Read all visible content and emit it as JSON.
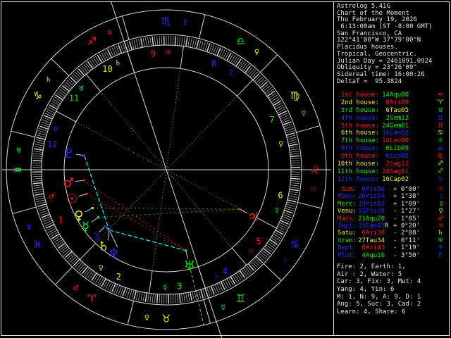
{
  "app_title": "Astrolog 5.41G",
  "panel": {
    "header_lines": [
      "Astrolog 5.41G",
      "Chart of the Moment",
      "Thu February 19, 2026",
      " 6:13:00am (ST -8:00 GMT)",
      "San Francisco, CA",
      "122°41'00\"W 37°79'00\"N",
      "Placidus houses.",
      "Tropical, Geocentric.",
      "Julian Day = 2461091.0924",
      "Obliquity = 23°26'09\"",
      "Sidereal time: 16:00:26",
      "DeltaT =  95.3824"
    ],
    "houses": [
      {
        "label": "1st house:",
        "value": "14Aqu00",
        "label_color": "#ff1818",
        "value_color": "#00ee00",
        "glyph": "♒",
        "glyph_color": "#ff1818"
      },
      {
        "label": "2nd house:",
        "value": "0Ari09",
        "label_color": "#eeee00",
        "value_color": "#ff1818",
        "glyph": "♈",
        "glyph_color": "#eeee00"
      },
      {
        "label": "3rd house:",
        "value": "6Tau05",
        "label_color": "#00ee00",
        "value_color": "#eeee00",
        "glyph": "♉",
        "glyph_color": "#00ee00"
      },
      {
        "label": "4th house:",
        "value": "2Gem12",
        "label_color": "#2a2aff",
        "value_color": "#00ee00",
        "glyph": "♊",
        "glyph_color": "#2a2aff"
      },
      {
        "label": "5th house:",
        "value": "24Gem01",
        "label_color": "#ff1818",
        "value_color": "#00ee00",
        "glyph": "♊",
        "glyph_color": "#ff1818"
      },
      {
        "label": "6th house:",
        "value": "16Can02",
        "label_color": "#eeee00",
        "value_color": "#2a2aff",
        "glyph": "♋",
        "glyph_color": "#eeee00"
      },
      {
        "label": "7th house:",
        "value": "14Leo00",
        "label_color": "#00ee00",
        "value_color": "#ff1818",
        "glyph": "♌",
        "glyph_color": "#00ee00"
      },
      {
        "label": "8th house:",
        "value": "0Lib09",
        "label_color": "#2a2aff",
        "value_color": "#00ee00",
        "glyph": "♎",
        "glyph_color": "#2a2aff"
      },
      {
        "label": "9th house:",
        "value": "6Sco05",
        "label_color": "#ff1818",
        "value_color": "#2a2aff",
        "glyph": "♏",
        "glyph_color": "#ff1818"
      },
      {
        "label": "10th house:",
        "value": "2Sag12",
        "label_color": "#eeee00",
        "value_color": "#ff1818",
        "glyph": "♐",
        "glyph_color": "#eeee00"
      },
      {
        "label": "11th house:",
        "value": "24Sag01",
        "label_color": "#00ee00",
        "value_color": "#ff1818",
        "glyph": "♐",
        "glyph_color": "#00ee00"
      },
      {
        "label": "12th house:",
        "value": "16Cap02",
        "label_color": "#2a2aff",
        "value_color": "#eeee00",
        "glyph": "♑",
        "glyph_color": "#2a2aff"
      }
    ],
    "planets": [
      {
        "name": "Sun:",
        "value": "0Pis56",
        "retro": " ",
        "velocity": "+ 0°00'",
        "name_color": "#ff1818",
        "value_color": "#2a2aff",
        "glyph": "☉",
        "glyph_color": "#ff1818"
      },
      {
        "name": "Moon:",
        "value": "26Pis54",
        "retro": " ",
        "velocity": "+ 1°38'",
        "name_color": "#2a2aff",
        "value_color": "#2a2aff",
        "glyph": "☽",
        "glyph_color": "#2a2aff"
      },
      {
        "name": "Merc:",
        "value": "19Pis02",
        "retro": " ",
        "velocity": "+ 1°09'",
        "name_color": "#00ee00",
        "value_color": "#2a2aff",
        "glyph": "☿",
        "glyph_color": "#00ee00"
      },
      {
        "name": "Venu:",
        "value": "11Pis28",
        "retro": " ",
        "velocity": "- 1°27'",
        "name_color": "#eeee00",
        "value_color": "#2a2aff",
        "glyph": "♀",
        "glyph_color": "#eeee00"
      },
      {
        "name": "Mars:",
        "value": "21Aqu20",
        "retro": " ",
        "velocity": "- 1°05'",
        "name_color": "#ff1818",
        "value_color": "#00ee00",
        "glyph": "♂",
        "glyph_color": "#ff1818"
      },
      {
        "name": "Jupi:",
        "value": "15Can43",
        "retro": "R",
        "velocity": "+ 0°20'",
        "name_color": "#2a2aff",
        "value_color": "#2a2aff",
        "glyph": "♃",
        "glyph_color": "#ff1818"
      },
      {
        "name": "Satu:",
        "value": "0Ari38",
        "retro": " ",
        "velocity": "- 2°08'",
        "name_color": "#eeee00",
        "value_color": "#ff1818",
        "glyph": "♄",
        "glyph_color": "#eeee00"
      },
      {
        "name": "Uran:",
        "value": "27Tau34",
        "retro": " ",
        "velocity": "- 0°11'",
        "name_color": "#00ee00",
        "value_color": "#eeee00",
        "glyph": "♅",
        "glyph_color": "#00ee00"
      },
      {
        "name": "Nept:",
        "value": "0Ari43",
        "retro": " ",
        "velocity": "- 1°19'",
        "name_color": "#2a2aff",
        "value_color": "#ff1818",
        "glyph": "♆",
        "glyph_color": "#2a2aff"
      },
      {
        "name": "Plut:",
        "value": "4Aqu16",
        "retro": " ",
        "velocity": "- 3°50'",
        "name_color": "#2a2aff",
        "value_color": "#00ee00",
        "glyph": "♇",
        "glyph_color": "#2a2aff"
      }
    ],
    "stats_lines": [
      "Fire: 2, Earth: 1,",
      "Air : 2, Water: 5",
      "Car: 3, Fix: 3, Mut: 4",
      "Yang: 4, Yin: 6",
      "M: 1, N: 9, A: 9, D: 1",
      "Ang: 5, Suc: 3, Cad: 2",
      "Learn: 4, Share: 6"
    ]
  },
  "wheel": {
    "ascendant_lon": 314.0,
    "house_cusps_lon": [
      314.0,
      0.15,
      36.083,
      62.2,
      84.017,
      106.033,
      134.0,
      180.15,
      216.083,
      242.2,
      264.017,
      286.033
    ],
    "house_numbers": [
      "1",
      "2",
      "3",
      "4",
      "5",
      "6",
      "7",
      "8",
      "9",
      "10",
      "11",
      "12"
    ],
    "house_number_colors": [
      "#ff1818",
      "#eeee00",
      "#00ee00",
      "#2a2aff",
      "#ff1818",
      "#eeee00",
      "#00ee00",
      "#2a2aff",
      "#ff1818",
      "#eeee00",
      "#00ee00",
      "#2a2aff"
    ],
    "house_ruler_glyphs": [
      "♂",
      "♀",
      "☿",
      "☽",
      "☉",
      "☿",
      "♀",
      "♇",
      "♃",
      "♄",
      "♅",
      "♆"
    ],
    "house_ruler_colors": [
      "#ff1818",
      "#eeee00",
      "#00ee00",
      "#2a2aff",
      "#ff1818",
      "#00ee00",
      "#eeee00",
      "#2a2aff",
      "#ff1818",
      "#eeee00",
      "#00ee00",
      "#2a2aff"
    ],
    "signs": [
      {
        "name": "Aries",
        "glyph": "♈",
        "color": "#ff1818",
        "ruler_glyph": "♂",
        "ruler_color": "#ff1818"
      },
      {
        "name": "Taurus",
        "glyph": "♉",
        "color": "#eeee00",
        "ruler_glyph": "♀",
        "ruler_color": "#eeee00"
      },
      {
        "name": "Gemini",
        "glyph": "♊",
        "color": "#00ee00",
        "ruler_glyph": "☿",
        "ruler_color": "#00ee00"
      },
      {
        "name": "Cancer",
        "glyph": "♋",
        "color": "#2a2aff",
        "ruler_glyph": "☽",
        "ruler_color": "#2a2aff"
      },
      {
        "name": "Leo",
        "glyph": "♌",
        "color": "#ff1818",
        "ruler_glyph": "☉",
        "ruler_color": "#ff1818"
      },
      {
        "name": "Virgo",
        "glyph": "♍",
        "color": "#eeee00",
        "ruler_glyph": "☿",
        "ruler_color": "#00ee00"
      },
      {
        "name": "Libra",
        "glyph": "♎",
        "color": "#00ee00",
        "ruler_glyph": "♀",
        "ruler_color": "#eeee00"
      },
      {
        "name": "Scorpio",
        "glyph": "♏",
        "color": "#2a2aff",
        "ruler_glyph": "♇",
        "ruler_color": "#2a2aff"
      },
      {
        "name": "Sagittarius",
        "glyph": "♐",
        "color": "#ff1818",
        "ruler_glyph": "♃",
        "ruler_color": "#ff1818"
      },
      {
        "name": "Capricorn",
        "glyph": "♑",
        "color": "#eeee00",
        "ruler_glyph": "♄",
        "ruler_color": "#eeee00"
      },
      {
        "name": "Aquarius",
        "glyph": "♒",
        "color": "#00ee00",
        "ruler_glyph": "♅",
        "ruler_color": "#00ee00"
      },
      {
        "name": "Pisces",
        "glyph": "♓",
        "color": "#2a2aff",
        "ruler_glyph": "♆",
        "ruler_color": "#2a2aff"
      }
    ],
    "planets": [
      {
        "name": "Sun",
        "glyph": "☉",
        "lon": 330.933,
        "color": "#ff1818"
      },
      {
        "name": "Moon",
        "glyph": "☽",
        "lon": 356.9,
        "color": "#2a2aff"
      },
      {
        "name": "Mercury",
        "glyph": "☿",
        "lon": 349.033,
        "color": "#00ee00"
      },
      {
        "name": "Venus",
        "glyph": "♀",
        "lon": 341.467,
        "color": "#eeee00"
      },
      {
        "name": "Mars",
        "glyph": "♂",
        "lon": 321.333,
        "color": "#ff1818"
      },
      {
        "name": "Jupiter",
        "glyph": "♃",
        "lon": 105.717,
        "color": "#ff1818"
      },
      {
        "name": "Saturn",
        "glyph": "♄",
        "lon": 0.633,
        "color": "#eeee00"
      },
      {
        "name": "Uranus",
        "glyph": "♅",
        "lon": 57.567,
        "color": "#00ee00"
      },
      {
        "name": "Neptune",
        "glyph": "♆",
        "lon": 0.717,
        "color": "#2a2aff"
      },
      {
        "name": "Pluto",
        "glyph": "♇",
        "lon": 304.267,
        "color": "#2a2aff"
      }
    ],
    "aspects": [
      {
        "a": "Mercury",
        "b": "Jupiter",
        "type": "trine"
      },
      {
        "a": "Venus",
        "b": "Jupiter",
        "type": "trine"
      },
      {
        "a": "Sun",
        "b": "Uranus",
        "type": "square"
      },
      {
        "a": "Mars",
        "b": "Uranus",
        "type": "square"
      },
      {
        "a": "Saturn",
        "b": "Uranus",
        "type": "sextile"
      },
      {
        "a": "Neptune",
        "b": "Uranus",
        "type": "sextile"
      },
      {
        "a": "Pluto",
        "b": "Saturn",
        "type": "sextile"
      },
      {
        "a": "Pluto",
        "b": "Neptune",
        "type": "sextile"
      },
      {
        "a": "Moon",
        "b": "Saturn",
        "type": "conjunction"
      },
      {
        "a": "Saturn",
        "b": "Neptune",
        "type": "conjunction"
      }
    ],
    "aspect_styles": {
      "trine": {
        "color": "#00dd00",
        "dash": "1.5,4.5"
      },
      "square": {
        "color": "#ff1818",
        "dash": "1.5,4.5"
      },
      "sextile": {
        "color": "#00ffff",
        "dash": "6,3"
      },
      "conjunction": {
        "color": "#eeee00",
        "dash": ""
      }
    }
  },
  "colors": {
    "background": "#000000",
    "frame": "#e6e6e6",
    "rings": "#dcdcdc",
    "axis": "#d8d8d8",
    "cusp_dotted": "#909090",
    "pointer": "#d0d0d0",
    "text": "#e6e6e6"
  }
}
